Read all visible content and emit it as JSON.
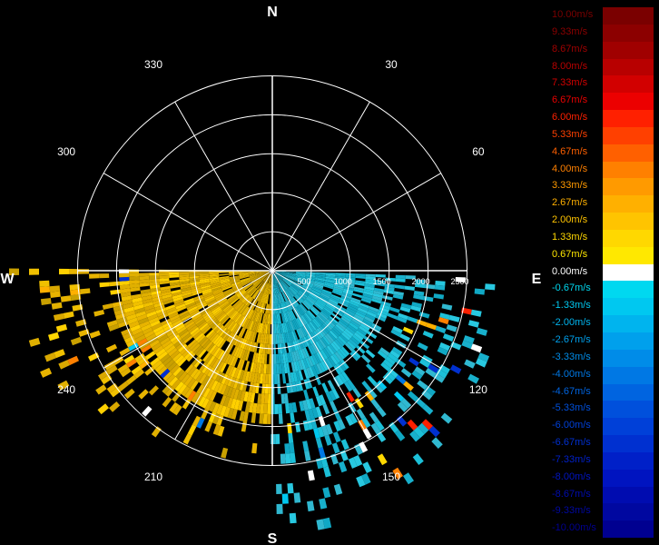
{
  "chart_data": {
    "type": "heatmap",
    "subtype": "doppler-radar-ppi-radial-velocity",
    "cardinals": [
      "N",
      "E",
      "S",
      "W"
    ],
    "azimuth_labels": [
      "30",
      "60",
      "120",
      "150",
      "210",
      "240",
      "300",
      "330"
    ],
    "range_labels": [
      "500",
      "1000",
      "1500",
      "2000",
      "2500"
    ],
    "range_max": 2750,
    "coverage_sector_deg": [
      90,
      270
    ],
    "legend": {
      "labels": [
        "10.00m/s",
        "9.33m/s",
        "8.67m/s",
        "8.00m/s",
        "7.33m/s",
        "6.67m/s",
        "6.00m/s",
        "5.33m/s",
        "4.67m/s",
        "4.00m/s",
        "3.33m/s",
        "2.67m/s",
        "2.00m/s",
        "1.33m/s",
        "0.67m/s",
        "0.00m/s",
        "-0.67m/s",
        "-1.33m/s",
        "-2.00m/s",
        "-2.67m/s",
        "-3.33m/s",
        "-4.00m/s",
        "-4.67m/s",
        "-5.33m/s",
        "-6.00m/s",
        "-6.67m/s",
        "-7.33m/s",
        "-8.00m/s",
        "-8.67m/s",
        "-9.33m/s",
        "-10.00m/s"
      ],
      "colors": [
        "#7a0000",
        "#8c0000",
        "#a00000",
        "#b80000",
        "#d20000",
        "#ec0000",
        "#ff2000",
        "#ff4000",
        "#ff6000",
        "#ff8000",
        "#ff9a00",
        "#ffb000",
        "#ffc400",
        "#ffd800",
        "#ffe800",
        "#ffffff",
        "#00d8f0",
        "#00c8f0",
        "#00b4ee",
        "#00a0ec",
        "#008ce8",
        "#0078e4",
        "#0064e0",
        "#0050dc",
        "#0040d8",
        "#0030d0",
        "#0020c8",
        "#0014c0",
        "#000cb0",
        "#0008a0",
        "#000090"
      ]
    },
    "observed_velocity_regions": [
      {
        "azimuth_deg": [
          180,
          270
        ],
        "velocity_ms": 1.3,
        "description_color": "yellow-gold"
      },
      {
        "azimuth_deg": [
          95,
          180
        ],
        "velocity_ms": -1.3,
        "description_color": "cyan"
      }
    ]
  }
}
